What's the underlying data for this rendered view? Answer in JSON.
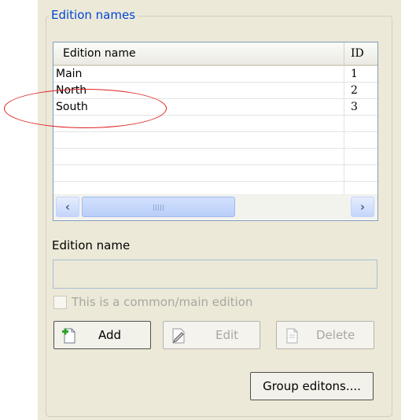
{
  "group": {
    "title": "Edition names"
  },
  "list": {
    "columns": [
      "Edition name",
      "ID"
    ],
    "rows": [
      {
        "name": "Main",
        "id": "1"
      },
      {
        "name": "North",
        "id": "2"
      },
      {
        "name": "South",
        "id": "3"
      }
    ]
  },
  "form": {
    "edition_name_label": "Edition name",
    "edition_name_value": "",
    "common_edition_label": "This is a common/main edition"
  },
  "buttons": {
    "add": "Add",
    "edit": "Edit",
    "delete": "Delete",
    "group": "Group editons...."
  },
  "colors": {
    "group_title": "#0046d5",
    "annotation": "#e02020"
  }
}
